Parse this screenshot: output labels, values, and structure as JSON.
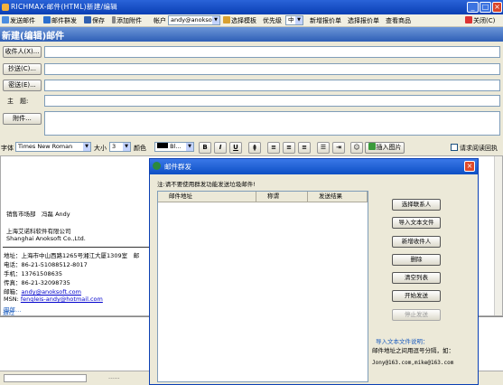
{
  "window": {
    "title": "RICHMAX-邮件(HTML)新建/编辑",
    "min": "_",
    "max": "□",
    "close": "×"
  },
  "toolbar": {
    "send": "发送邮件",
    "group_send": "邮件群发",
    "save": "保存",
    "attach": "添加附件",
    "account_label": "帐户",
    "account_value": "andy@anoksoft",
    "template": "选择模板",
    "priority_label": "优先级",
    "priority_value": "中",
    "new_quote": "新增报价单",
    "choose_quote": "选择报价单",
    "view_goods": "查看商品",
    "close": "关闭(C)"
  },
  "header": {
    "title": "新建(编辑)邮件"
  },
  "form": {
    "to_label": "收件人(X)...",
    "cc_label": "抄送(C)...",
    "bcc_label": "密送(E)...",
    "subject_label": "主　题:",
    "attach_label": "附件...",
    "to_value": "",
    "cc_value": "",
    "bcc_value": "",
    "subject_value": "",
    "attach_value": ""
  },
  "format": {
    "font_label": "字体",
    "font_value": "Times New Roman",
    "size_label": "大小",
    "size_value": "3",
    "color_label": "颜色",
    "color_value": "Bl...",
    "bold": "B",
    "italic": "I",
    "underline": "U",
    "insert_image": "插入图片",
    "read_receipt": "请求阅读回执"
  },
  "signature": {
    "dept": "销售市场部　冯磊 Andy",
    "company_cn": "上海艾诺科软件有限公司",
    "company_en": "Shanghai Anoksoft Co.,Ltd.",
    "address": "地址：上海市中山西路1265号湘江大厦1309室　邮",
    "phone": "电话：86-21-51088512-8017",
    "mobile": "手机：13761508635",
    "fax": "传真：86-21-32098735",
    "email_label": "邮箱：",
    "email": "andy@anoksoft.com",
    "msn_label": "MSN: ",
    "msn": "fengleis-andy@hotmail.com",
    "cut_line": "四郎…",
    "link": "通过"
  },
  "statusbar": {
    "text": "......"
  },
  "dialog": {
    "title": "邮件群发",
    "close": "×",
    "note": "注:请不要使用群发功能发送垃圾邮件!",
    "columns": [
      "邮件地址",
      "称谓",
      "发送结果"
    ],
    "buttons": [
      "选择联系人",
      "导入文本文件",
      "新增收件人",
      "删除",
      "清空列表",
      "开始发送",
      "停止发送"
    ],
    "hint_title": "导入文本文件说明：",
    "hint_body": "邮件地址之间用逗号分隔，如：",
    "hint_example": "Jony@163.com,mike@163.com"
  },
  "colors": {
    "title_bar": "#0a3fb4",
    "header_bar": "#4a7bc8",
    "accent_blue": "#1f5fbf"
  }
}
